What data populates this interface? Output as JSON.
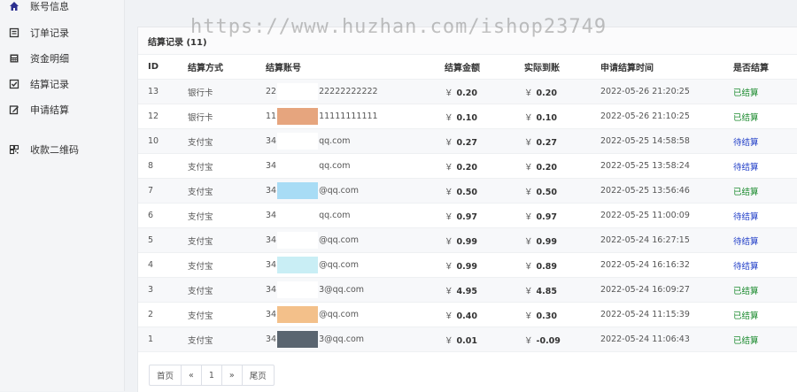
{
  "watermark": "https://www.huzhan.com/ishop23749",
  "sidebar": {
    "items": [
      {
        "label": "账号信息",
        "icon": "home-icon"
      },
      {
        "label": "订单记录",
        "icon": "list-icon"
      },
      {
        "label": "资金明细",
        "icon": "calculator-icon"
      },
      {
        "label": "结算记录",
        "icon": "check-square-icon"
      },
      {
        "label": "申请结算",
        "icon": "edit-icon"
      },
      {
        "label": "收款二维码",
        "icon": "qrcode-icon"
      }
    ]
  },
  "card": {
    "title": "结算记录 (11)"
  },
  "table": {
    "headers": [
      "ID",
      "结算方式",
      "结算账号",
      "结算金额",
      "实际到账",
      "申请结算时间",
      "是否结算"
    ],
    "currency": "￥",
    "rows": [
      {
        "id": "13",
        "method": "银行卡",
        "acct_pre": "22",
        "acct_post": "22222222222",
        "amount": "0.20",
        "real": "0.20",
        "time": "2022-05-26 21:20:25",
        "status": "已结算",
        "done": true,
        "blur": "#ffffff"
      },
      {
        "id": "12",
        "method": "银行卡",
        "acct_pre": "11",
        "acct_post": "11111111111",
        "amount": "0.10",
        "real": "0.10",
        "time": "2022-05-26 21:10:25",
        "status": "已结算",
        "done": true,
        "blur": "#e6a57e"
      },
      {
        "id": "10",
        "method": "支付宝",
        "acct_pre": "34",
        "acct_post": "qq.com",
        "amount": "0.27",
        "real": "0.27",
        "time": "2022-05-25 14:58:58",
        "status": "待结算",
        "done": false,
        "blur": "#ffffff"
      },
      {
        "id": "8",
        "method": "支付宝",
        "acct_pre": "34",
        "acct_post": "qq.com",
        "amount": "0.20",
        "real": "0.20",
        "time": "2022-05-25 13:58:24",
        "status": "待结算",
        "done": false,
        "blur": "#ffffff"
      },
      {
        "id": "7",
        "method": "支付宝",
        "acct_pre": "34",
        "acct_post": "@qq.com",
        "amount": "0.50",
        "real": "0.50",
        "time": "2022-05-25 13:56:46",
        "status": "已结算",
        "done": true,
        "blur": "#a8dcf5"
      },
      {
        "id": "6",
        "method": "支付宝",
        "acct_pre": "34",
        "acct_post": "qq.com",
        "amount": "0.97",
        "real": "0.97",
        "time": "2022-05-25 11:00:09",
        "status": "待结算",
        "done": false,
        "blur": "#ffffff"
      },
      {
        "id": "5",
        "method": "支付宝",
        "acct_pre": "34",
        "acct_post": "@qq.com",
        "amount": "0.99",
        "real": "0.99",
        "time": "2022-05-24 16:27:15",
        "status": "待结算",
        "done": false,
        "blur": "#ffffff"
      },
      {
        "id": "4",
        "method": "支付宝",
        "acct_pre": "34",
        "acct_post": "@qq.com",
        "amount": "0.99",
        "real": "0.89",
        "time": "2022-05-24 16:16:32",
        "status": "待结算",
        "done": false,
        "blur": "#c9eef5"
      },
      {
        "id": "3",
        "method": "支付宝",
        "acct_pre": "34",
        "acct_post": "3@qq.com",
        "amount": "4.95",
        "real": "4.85",
        "time": "2022-05-24 16:09:27",
        "status": "已结算",
        "done": true,
        "blur": "#ffffff"
      },
      {
        "id": "2",
        "method": "支付宝",
        "acct_pre": "34",
        "acct_post": "@qq.com",
        "amount": "0.40",
        "real": "0.30",
        "time": "2022-05-24 11:15:39",
        "status": "已结算",
        "done": true,
        "blur": "#f3c08a"
      },
      {
        "id": "1",
        "method": "支付宝",
        "acct_pre": "34",
        "acct_post": "3@qq.com",
        "amount": "0.01",
        "real": "-0.09",
        "time": "2022-05-24 11:06:43",
        "status": "已结算",
        "done": true,
        "blur": "#5a6570"
      }
    ]
  },
  "pager": {
    "first": "首页",
    "prev": "«",
    "current": "1",
    "next": "»",
    "last": "尾页"
  },
  "colors": {
    "done": "#1c8b2f",
    "wait": "#2340c8"
  }
}
